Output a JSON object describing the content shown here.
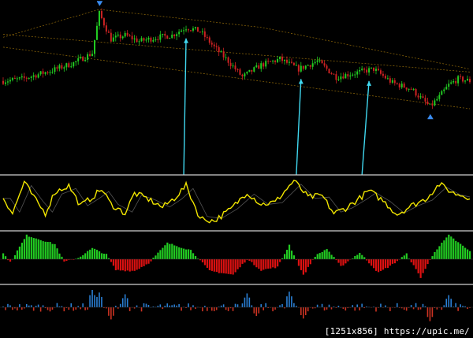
{
  "watermark": "[1251x856] https://upic.me/",
  "colors": {
    "background": "#000000",
    "bull": "#22cc22",
    "bear": "#cc2222",
    "channel": "#b8860b",
    "arrow": "#40d8f0",
    "oscillator": "#f2e600",
    "oscillator_shadow": "#8a8a8a",
    "histogram_pos": "#22cc22",
    "histogram_neg": "#dd1111",
    "volume_pos": "#2a7fd4",
    "volume_neg": "#cc3322",
    "separator": "#cfcfcf"
  },
  "chart_data": [
    {
      "type": "candlestick",
      "panel": "price",
      "description_hidden": false,
      "x": "bar index 0-199",
      "close_path": [
        [
          0,
          0.28
        ],
        [
          8,
          0.3
        ],
        [
          20,
          0.38
        ],
        [
          30,
          0.46
        ],
        [
          38,
          0.56
        ],
        [
          41,
          0.96
        ],
        [
          46,
          0.7
        ],
        [
          52,
          0.74
        ],
        [
          58,
          0.68
        ],
        [
          66,
          0.72
        ],
        [
          72,
          0.74
        ],
        [
          78,
          0.82
        ],
        [
          84,
          0.78
        ],
        [
          90,
          0.62
        ],
        [
          96,
          0.48
        ],
        [
          102,
          0.32
        ],
        [
          110,
          0.44
        ],
        [
          118,
          0.5
        ],
        [
          126,
          0.4
        ],
        [
          134,
          0.48
        ],
        [
          142,
          0.32
        ],
        [
          150,
          0.36
        ],
        [
          158,
          0.4
        ],
        [
          166,
          0.26
        ],
        [
          174,
          0.2
        ],
        [
          182,
          0.02
        ],
        [
          186,
          0.12
        ],
        [
          190,
          0.24
        ],
        [
          194,
          0.3
        ],
        [
          199,
          0.28
        ]
      ],
      "channel_upper": [
        [
          0,
          0.75
        ],
        [
          199,
          0.37
        ]
      ],
      "channel_lower": [
        [
          0,
          0.62
        ],
        [
          199,
          0.0
        ]
      ],
      "channel_top_dotted": [
        [
          0,
          0.72
        ],
        [
          41,
          1.0
        ],
        [
          110,
          0.82
        ],
        [
          199,
          0.4
        ]
      ],
      "markers": [
        {
          "bar": 41,
          "kind": "sell-arrow"
        },
        {
          "bar": 182,
          "kind": "buy-arrow"
        }
      ],
      "signals": [
        {
          "from_bar": 77,
          "to_bar": 78,
          "kind": "cyan-arrow"
        },
        {
          "from_bar": 125,
          "to_bar": 127,
          "kind": "cyan-arrow"
        },
        {
          "from_bar": 153,
          "to_bar": 156,
          "kind": "cyan-arrow"
        }
      ]
    },
    {
      "type": "line",
      "panel": "oscillator",
      "ylim": [
        0,
        1
      ],
      "x": "bar index 0-199",
      "pivots": [
        [
          0,
          0.62
        ],
        [
          4,
          0.3
        ],
        [
          9,
          0.92
        ],
        [
          14,
          0.55
        ],
        [
          18,
          0.3
        ],
        [
          22,
          0.72
        ],
        [
          28,
          0.85
        ],
        [
          33,
          0.45
        ],
        [
          38,
          0.62
        ],
        [
          42,
          0.78
        ],
        [
          46,
          0.48
        ],
        [
          52,
          0.3
        ],
        [
          56,
          0.7
        ],
        [
          62,
          0.58
        ],
        [
          68,
          0.42
        ],
        [
          73,
          0.6
        ],
        [
          78,
          0.85
        ],
        [
          84,
          0.2
        ],
        [
          90,
          0.15
        ],
        [
          97,
          0.38
        ],
        [
          104,
          0.72
        ],
        [
          110,
          0.48
        ],
        [
          116,
          0.52
        ],
        [
          124,
          0.95
        ],
        [
          130,
          0.62
        ],
        [
          136,
          0.65
        ],
        [
          141,
          0.3
        ],
        [
          146,
          0.4
        ],
        [
          152,
          0.6
        ],
        [
          156,
          0.75
        ],
        [
          162,
          0.55
        ],
        [
          168,
          0.28
        ],
        [
          174,
          0.45
        ],
        [
          180,
          0.58
        ],
        [
          186,
          0.88
        ],
        [
          192,
          0.7
        ],
        [
          199,
          0.62
        ]
      ]
    },
    {
      "type": "bar",
      "panel": "histogram",
      "ylim": [
        -1,
        1
      ],
      "x": "bar index 0-199",
      "pivots": [
        [
          0,
          0.22
        ],
        [
          3,
          -0.12
        ],
        [
          10,
          0.92
        ],
        [
          22,
          0.58
        ],
        [
          26,
          -0.1
        ],
        [
          32,
          0.05
        ],
        [
          38,
          0.42
        ],
        [
          44,
          0.18
        ],
        [
          48,
          -0.42
        ],
        [
          56,
          -0.45
        ],
        [
          62,
          -0.15
        ],
        [
          70,
          0.62
        ],
        [
          80,
          0.35
        ],
        [
          88,
          -0.45
        ],
        [
          98,
          -0.6
        ],
        [
          104,
          0.0
        ],
        [
          110,
          -0.42
        ],
        [
          117,
          -0.3
        ],
        [
          122,
          0.55
        ],
        [
          128,
          -0.62
        ],
        [
          133,
          0.12
        ],
        [
          138,
          0.4
        ],
        [
          144,
          -0.28
        ],
        [
          152,
          0.25
        ],
        [
          160,
          -0.52
        ],
        [
          166,
          -0.2
        ],
        [
          172,
          0.2
        ],
        [
          178,
          -0.7
        ],
        [
          184,
          0.3
        ],
        [
          190,
          0.92
        ],
        [
          199,
          0.3
        ]
      ]
    },
    {
      "type": "bar",
      "panel": "volume",
      "ylim": [
        -1,
        1
      ],
      "x": "bar index 0-199",
      "amplitude": 0.25,
      "spikes": [
        [
          38,
          1.0
        ],
        [
          41,
          0.85
        ],
        [
          46,
          -0.7
        ],
        [
          52,
          0.75
        ],
        [
          104,
          0.8
        ],
        [
          108,
          -0.5
        ],
        [
          122,
          0.9
        ],
        [
          128,
          -0.65
        ],
        [
          190,
          0.7
        ],
        [
          182,
          -0.8
        ]
      ]
    }
  ]
}
